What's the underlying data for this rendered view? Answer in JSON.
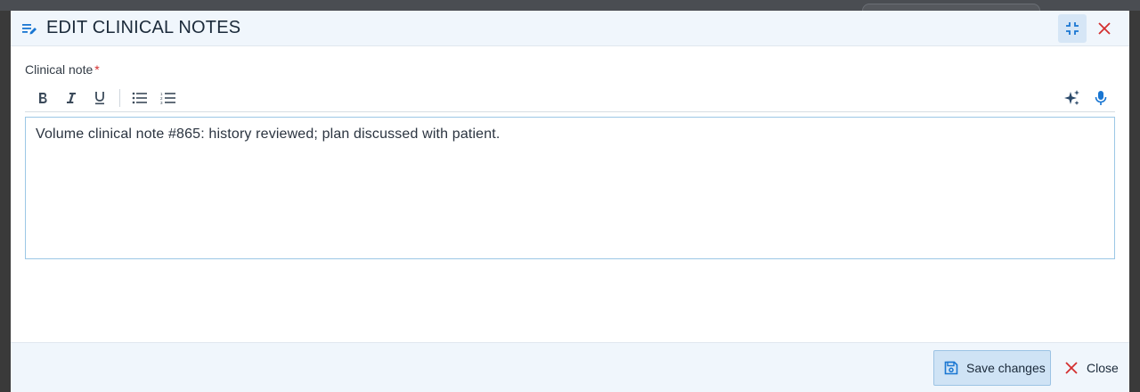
{
  "modal": {
    "title": "EDIT CLINICAL NOTES",
    "header_icon": "edit-note-icon",
    "minimize_icon": "collapse-icon",
    "close_icon": "close-icon"
  },
  "form": {
    "label": "Clinical note",
    "required_marker": "*",
    "toolbar": {
      "left": [
        "bold-icon",
        "italic-icon",
        "underline-icon",
        "bulleted-list-icon",
        "numbered-list-icon"
      ],
      "right": [
        "ai-sparkle-icon",
        "microphone-icon"
      ]
    },
    "note_text": "Volume clinical note #865: history reviewed; plan discussed with patient."
  },
  "footer": {
    "save_label": "Save changes",
    "close_label": "Close"
  },
  "colors": {
    "accent": "#1976d2",
    "danger": "#d32f2f",
    "header_bg": "#f0f6fc",
    "save_bg": "#cfe3f5"
  }
}
